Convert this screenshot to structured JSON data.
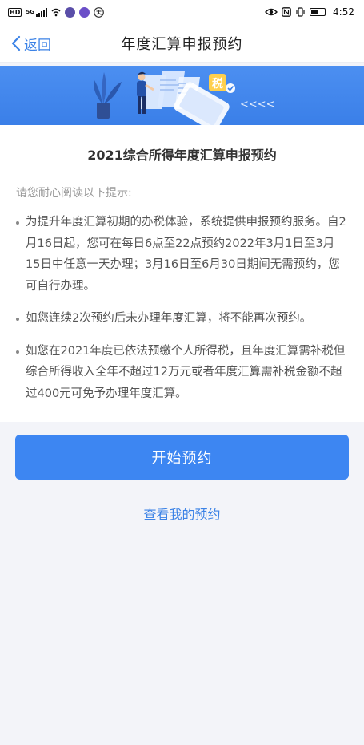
{
  "status_bar": {
    "hd": "HD",
    "network": "5G",
    "time": "4:52"
  },
  "nav": {
    "back_label": "返回",
    "title": "年度汇算申报预约"
  },
  "banner": {
    "tax_sign": "税",
    "arrows": "<<<<"
  },
  "card": {
    "title": "2021综合所得年度汇算申报预约",
    "hint": "请您耐心阅读以下提示:",
    "tips": [
      "为提升年度汇算初期的办税体验，系统提供申报预约服务。自2月16日起，您可在每日6点至22点预约2022年3月1日至3月15日中任意一天办理；3月16日至6月30日期间无需预约，您可自行办理。",
      "如您连续2次预约后未办理年度汇算，将不能再次预约。",
      "如您在2021年度已依法预缴个人所得税，且年度汇算需补税但综合所得收入全年不超过12万元或者年度汇算需补税金额不超过400元可免予办理年度汇算。"
    ]
  },
  "actions": {
    "primary_label": "开始预约",
    "secondary_label": "查看我的预约"
  },
  "colors": {
    "accent": "#3d86f2",
    "link": "#3b82e6",
    "background": "#f3f4f9"
  }
}
